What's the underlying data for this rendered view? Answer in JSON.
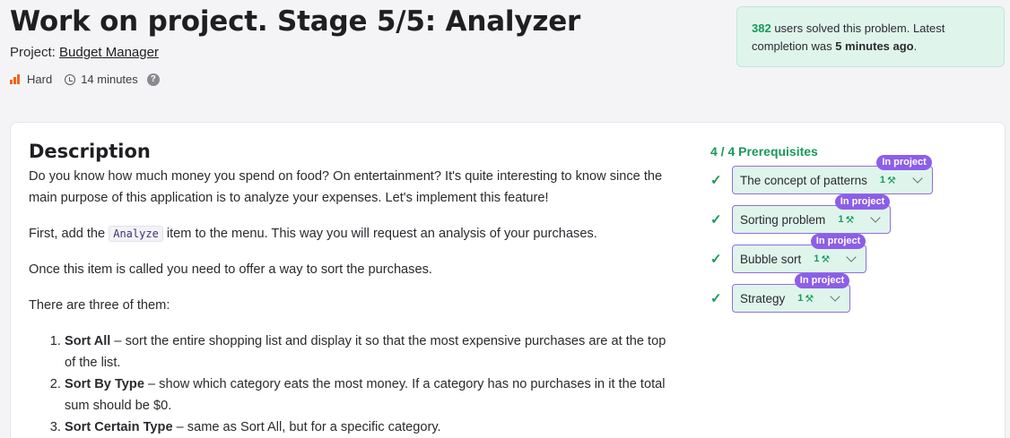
{
  "header": {
    "title": "Work on project. Stage 5/5: Analyzer",
    "project_label": "Project:",
    "project_name": "Budget Manager",
    "difficulty": "Hard",
    "duration": "14 minutes",
    "help": "?"
  },
  "solved": {
    "count": "382",
    "text_a": " users solved this problem. Latest completion was ",
    "recency": "5 minutes ago",
    "text_b": "."
  },
  "description": {
    "title": "Description",
    "p1": "Do you know how much money you spend on food? On entertainment? It's quite interesting to know since the main purpose of this application is to analyze your expenses. Let's implement this feature!",
    "p2_before": "First, add the ",
    "p2_code": "Analyze",
    "p2_after": " item to the menu. This way you will request an analysis of your purchases.",
    "p3": "Once this item is called you need to offer a way to sort the purchases.",
    "p4": "There are three of them:",
    "list": [
      {
        "bold": "Sort All",
        "text": " – sort the entire shopping list and display it so that the most expensive purchases are at the top of the list."
      },
      {
        "bold": "Sort By Type",
        "text": " – show which category eats the most money. If a category has no purchases in it the total sum should be $0."
      },
      {
        "bold": "Sort Certain Type",
        "text": " – same as Sort All, but for a specific category."
      }
    ]
  },
  "prerequisites": {
    "heading": "4 / 4 Prerequisites",
    "badge": "In project",
    "items": [
      {
        "label": "The concept of patterns",
        "count": "1"
      },
      {
        "label": "Sorting problem",
        "count": "1"
      },
      {
        "label": "Bubble sort",
        "count": "1"
      },
      {
        "label": "Strategy",
        "count": "1"
      }
    ]
  },
  "colors": {
    "accent_green": "#169a5a",
    "badge_purple": "#8d5ee8",
    "difficulty_orange": "#f0641c"
  }
}
